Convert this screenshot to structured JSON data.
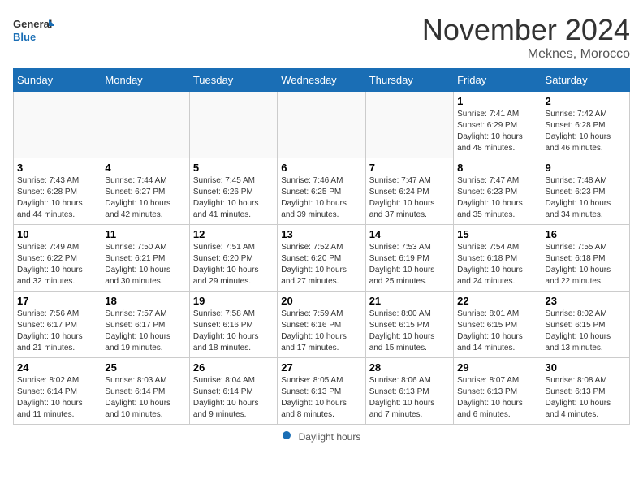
{
  "app": {
    "logo_line1": "General",
    "logo_line2": "Blue"
  },
  "header": {
    "month_year": "November 2024",
    "location": "Meknes, Morocco"
  },
  "weekdays": [
    "Sunday",
    "Monday",
    "Tuesday",
    "Wednesday",
    "Thursday",
    "Friday",
    "Saturday"
  ],
  "weeks": [
    [
      {
        "day": "",
        "info": ""
      },
      {
        "day": "",
        "info": ""
      },
      {
        "day": "",
        "info": ""
      },
      {
        "day": "",
        "info": ""
      },
      {
        "day": "",
        "info": ""
      },
      {
        "day": "1",
        "info": "Sunrise: 7:41 AM\nSunset: 6:29 PM\nDaylight: 10 hours and 48 minutes."
      },
      {
        "day": "2",
        "info": "Sunrise: 7:42 AM\nSunset: 6:28 PM\nDaylight: 10 hours and 46 minutes."
      }
    ],
    [
      {
        "day": "3",
        "info": "Sunrise: 7:43 AM\nSunset: 6:28 PM\nDaylight: 10 hours and 44 minutes."
      },
      {
        "day": "4",
        "info": "Sunrise: 7:44 AM\nSunset: 6:27 PM\nDaylight: 10 hours and 42 minutes."
      },
      {
        "day": "5",
        "info": "Sunrise: 7:45 AM\nSunset: 6:26 PM\nDaylight: 10 hours and 41 minutes."
      },
      {
        "day": "6",
        "info": "Sunrise: 7:46 AM\nSunset: 6:25 PM\nDaylight: 10 hours and 39 minutes."
      },
      {
        "day": "7",
        "info": "Sunrise: 7:47 AM\nSunset: 6:24 PM\nDaylight: 10 hours and 37 minutes."
      },
      {
        "day": "8",
        "info": "Sunrise: 7:47 AM\nSunset: 6:23 PM\nDaylight: 10 hours and 35 minutes."
      },
      {
        "day": "9",
        "info": "Sunrise: 7:48 AM\nSunset: 6:23 PM\nDaylight: 10 hours and 34 minutes."
      }
    ],
    [
      {
        "day": "10",
        "info": "Sunrise: 7:49 AM\nSunset: 6:22 PM\nDaylight: 10 hours and 32 minutes."
      },
      {
        "day": "11",
        "info": "Sunrise: 7:50 AM\nSunset: 6:21 PM\nDaylight: 10 hours and 30 minutes."
      },
      {
        "day": "12",
        "info": "Sunrise: 7:51 AM\nSunset: 6:20 PM\nDaylight: 10 hours and 29 minutes."
      },
      {
        "day": "13",
        "info": "Sunrise: 7:52 AM\nSunset: 6:20 PM\nDaylight: 10 hours and 27 minutes."
      },
      {
        "day": "14",
        "info": "Sunrise: 7:53 AM\nSunset: 6:19 PM\nDaylight: 10 hours and 25 minutes."
      },
      {
        "day": "15",
        "info": "Sunrise: 7:54 AM\nSunset: 6:18 PM\nDaylight: 10 hours and 24 minutes."
      },
      {
        "day": "16",
        "info": "Sunrise: 7:55 AM\nSunset: 6:18 PM\nDaylight: 10 hours and 22 minutes."
      }
    ],
    [
      {
        "day": "17",
        "info": "Sunrise: 7:56 AM\nSunset: 6:17 PM\nDaylight: 10 hours and 21 minutes."
      },
      {
        "day": "18",
        "info": "Sunrise: 7:57 AM\nSunset: 6:17 PM\nDaylight: 10 hours and 19 minutes."
      },
      {
        "day": "19",
        "info": "Sunrise: 7:58 AM\nSunset: 6:16 PM\nDaylight: 10 hours and 18 minutes."
      },
      {
        "day": "20",
        "info": "Sunrise: 7:59 AM\nSunset: 6:16 PM\nDaylight: 10 hours and 17 minutes."
      },
      {
        "day": "21",
        "info": "Sunrise: 8:00 AM\nSunset: 6:15 PM\nDaylight: 10 hours and 15 minutes."
      },
      {
        "day": "22",
        "info": "Sunrise: 8:01 AM\nSunset: 6:15 PM\nDaylight: 10 hours and 14 minutes."
      },
      {
        "day": "23",
        "info": "Sunrise: 8:02 AM\nSunset: 6:15 PM\nDaylight: 10 hours and 13 minutes."
      }
    ],
    [
      {
        "day": "24",
        "info": "Sunrise: 8:02 AM\nSunset: 6:14 PM\nDaylight: 10 hours and 11 minutes."
      },
      {
        "day": "25",
        "info": "Sunrise: 8:03 AM\nSunset: 6:14 PM\nDaylight: 10 hours and 10 minutes."
      },
      {
        "day": "26",
        "info": "Sunrise: 8:04 AM\nSunset: 6:14 PM\nDaylight: 10 hours and 9 minutes."
      },
      {
        "day": "27",
        "info": "Sunrise: 8:05 AM\nSunset: 6:13 PM\nDaylight: 10 hours and 8 minutes."
      },
      {
        "day": "28",
        "info": "Sunrise: 8:06 AM\nSunset: 6:13 PM\nDaylight: 10 hours and 7 minutes."
      },
      {
        "day": "29",
        "info": "Sunrise: 8:07 AM\nSunset: 6:13 PM\nDaylight: 10 hours and 6 minutes."
      },
      {
        "day": "30",
        "info": "Sunrise: 8:08 AM\nSunset: 6:13 PM\nDaylight: 10 hours and 4 minutes."
      }
    ]
  ],
  "footer": {
    "daylight_label": "Daylight hours"
  }
}
